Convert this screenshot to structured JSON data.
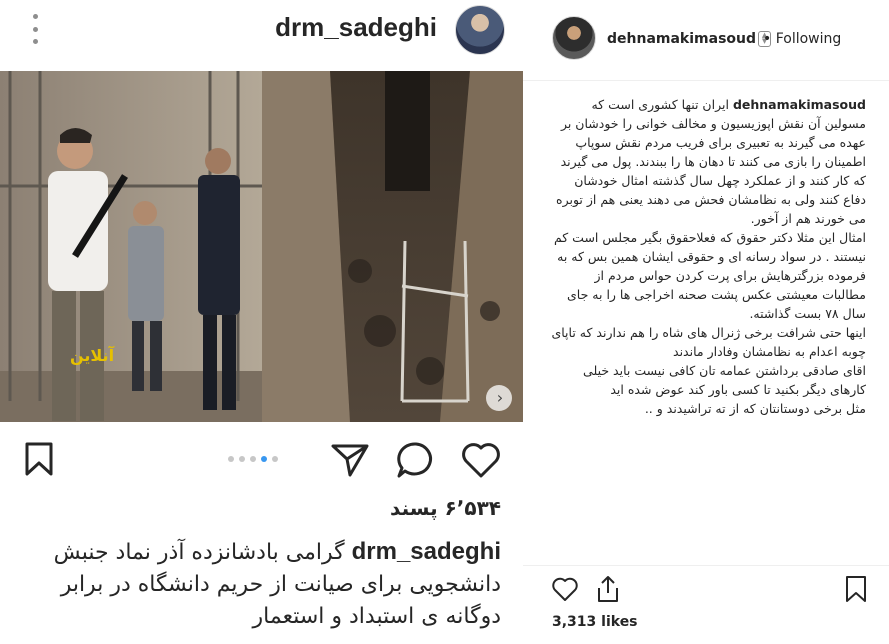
{
  "post": {
    "username": "drm_sadeghi",
    "likes_fa": "۶٬۵۳۴ پسند",
    "caption_user": "drm_sadeghi",
    "caption_text": " گرامی بادشانزده آذر نماد جنبش دانشجویی برای صیانت از حریم دانشگاه در برابر دوگانه ی استبداد و استعمار",
    "carousel": {
      "count": 5,
      "active_index": 3
    },
    "next_icon": "chevron-right-icon"
  },
  "comment_panel": {
    "username": "dehnamakimasoud",
    "follow_label": "• Following",
    "comment_user": "dehnamakimasoud",
    "paragraphs": [
      "ایران تنها کشوری است که مسولین آن نقش اپوزیسیون و مخالف خوانی را خودشان بر عهده می گیرند به تعبیری برای فریب مردم نقش سوپاپ اطمینان را بازی می کنند تا دهان ها را ببندند. پول می گیرند که کار کنند و از عملکرد چهل سال گذشته امثال خودشان دفاع کنند ولی به نظامشان فحش می دهند یعنی هم از توبره می خورند هم از آخور.",
      "امثال این مثلا دکتر حقوق که فعلاحقوق بگیر مجلس است کم نیستند . در سواد رسانه ای و حقوقی ایشان همین بس که به فرموده بزرگترهایش برای پرت کردن حواس مردم از مطالبات معیشتی عکس پشت صحنه اخراجی ها را به جای سال ۷۸ بست گذاشته.",
      "اینها حتی شرافت برخی ژنرال های شاه را هم ندارند که تاپای چوبه اعدام به نظامشان وفادار ماندند",
      "اقای صادقی برداشتن عمامه تان کافی نیست باید خیلی کارهای دیگر بکنید تا کسی باور کند عوض شده اید",
      "مثل برخی دوستانتان که از ته تراشیدند و .."
    ],
    "likes": "3,313 likes"
  },
  "colors": {
    "accent": "#3897f0",
    "text": "#262626",
    "muted": "#8e8e8e",
    "border": "#efefef"
  }
}
